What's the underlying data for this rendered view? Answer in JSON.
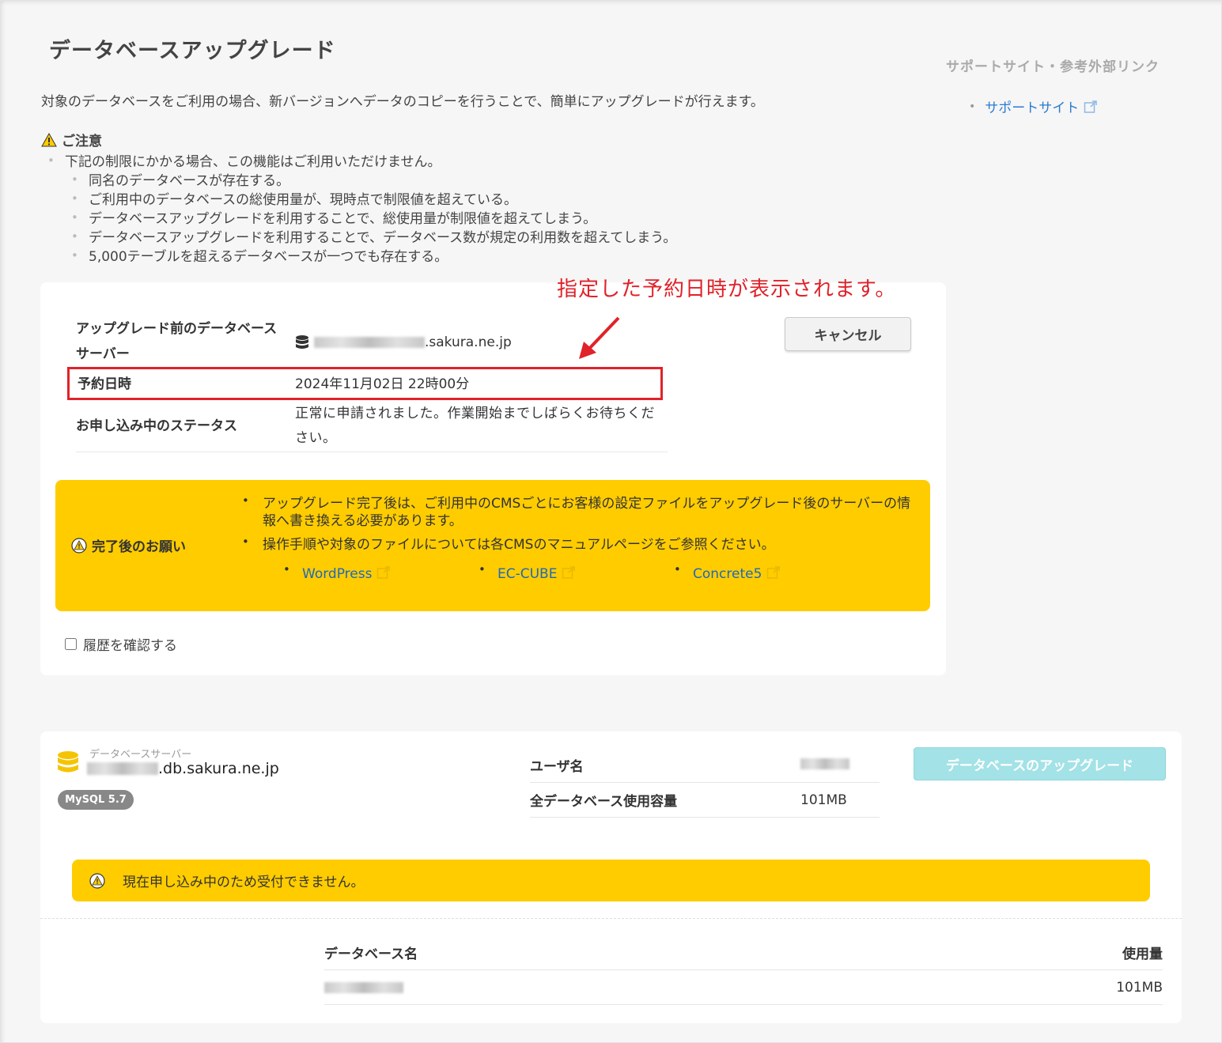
{
  "page_title": "データベースアップグレード",
  "intro": "対象のデータベースをご利用の場合、新バージョンへデータのコピーを行うことで、簡単にアップグレードが行えます。",
  "notice": {
    "heading": "ご注意",
    "lead": "下記の制限にかかる場合、この機能はご利用いただけません。",
    "items": [
      "同名のデータベースが存在する。",
      "ご利用中のデータベースの総使用量が、現時点で制限値を超えている。",
      "データベースアップグレードを利用することで、総使用量が制限値を超えてしまう。",
      "データベースアップグレードを利用することで、データベース数が規定の利用数を超えてしまう。",
      "5,000テーブルを超えるデータベースが一つでも存在する。"
    ]
  },
  "sidebar": {
    "title": "サポートサイト・参考外部リンク",
    "link": "サポートサイト"
  },
  "annotation": "指定した予約日時が表示されます。",
  "reservation": {
    "rows": [
      {
        "key": "アップグレード前のデータベースサーバー",
        "value": ".sakura.ne.jp"
      },
      {
        "key": "予約日時",
        "value": "2024年11月02日 22時00分"
      },
      {
        "key": "お申し込み中のステータス",
        "value": "正常に申請されました。作業開始までしばらくお待ちください。"
      }
    ],
    "cancel_label": "キャンセル"
  },
  "after_notice": {
    "label": "完了後のお願い",
    "items": [
      "アップグレード完了後は、ご利用中のCMSごとにお客様の設定ファイルをアップグレード後のサーバーの情報へ書き換える必要があります。",
      "操作手順や対象のファイルについては各CMSのマニュアルページをご参照ください。"
    ],
    "links": [
      "WordPress",
      "EC-CUBE",
      "Concrete5"
    ]
  },
  "history_label": "履歴を確認する",
  "server": {
    "label": "データベースサーバー",
    "host": ".db.sakura.ne.jp",
    "badge": "MySQL 5.7",
    "user_key": "ユーザ名",
    "usage_key": "全データベース使用容量",
    "usage_value": "101MB",
    "upgrade_label": "データベースのアップグレード",
    "busy_message": "現在申し込み中のため受付できません。"
  },
  "db_table": {
    "col_name": "データベース名",
    "col_usage": "使用量",
    "rows": [
      {
        "usage": "101MB"
      }
    ]
  },
  "colors": {
    "accent_yellow": "#ffcc00",
    "link_blue": "#2a7bd2",
    "annotation_red": "#e0222a",
    "disabled_teal": "#a3e2e6"
  }
}
